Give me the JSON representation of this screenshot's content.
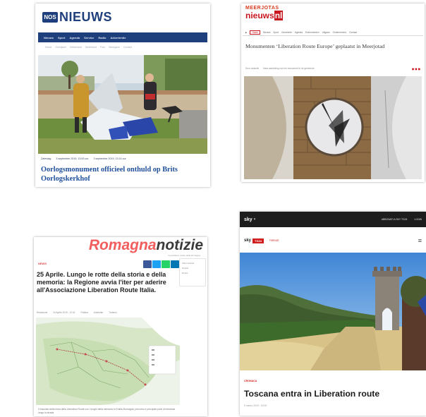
{
  "card1": {
    "logo_badge": "NOS",
    "logo_text": "NIEUWS",
    "nav": [
      "Nieuws",
      "Sport",
      "Agenda",
      "Service",
      "Radio",
      "Advertentie"
    ],
    "subnav": [
      "Home",
      "Overijssel",
      "Gelderland",
      "Nederland",
      "Foto",
      "Weergave",
      "Contact"
    ],
    "meta": [
      "Zaterdag",
      "3 september 2019, 13:00 uur",
      "3 september 2019, 13:14 uur"
    ],
    "headline": "Oorlogsmonument officieel onthuld op Brits Oorlogskerkhof"
  },
  "card2": {
    "logo_top": "MEERJOTAS",
    "logo_main_a": "nieuws",
    "logo_main_b": "nl",
    "nav": [
      "▶",
      "Home",
      "Nieuws",
      "Sport",
      "Gemeente",
      "Agenda",
      "Evenementen",
      "Uitgaan",
      "Ondernemers",
      "Contact"
    ],
    "nav_active": "Home",
    "headline": "Monumenten ‘Liberation Route Europe’ geplaatst in Meerjotad",
    "meta": [
      "Door redactie",
      "Naar aanleiding van het monument in de gemeente"
    ],
    "meta_icons": "◼ ◼ ◼"
  },
  "card3": {
    "logo_a": "Romagna",
    "logo_b": "notizie",
    "tagline": "il quotidiano online della Romagna",
    "category": "NEWS",
    "headline": "25 Aprile. Lungo le rotte della storia e della memoria: la Regione avvia l'iter per aderire all'Associazione Liberation Route Italia.",
    "meta": [
      "Redazione",
      "24 Aprile 2019 - 12:42",
      "Politica",
      "Ambiente",
      "Turismo"
    ],
    "sidebar": [
      "Ultimi articoli",
      "Notizie",
      "Rimini"
    ],
    "caption": "Il tracciato della linea della Liberation Route con i luoghi della memoria in Emilia-Romagna, percorso e principali punti di interesse lungo la strada"
  },
  "card4": {
    "sky": "sky",
    "top_right": [
      "ABBONATI A SKY TG24",
      "LOGIN"
    ],
    "sky_small": "sky",
    "tg": "TG24",
    "section": "FIRENZE",
    "category": "CRONACA",
    "headline": "Toscana entra in Liberation route",
    "date": "5 marzo 2019 - 15:00"
  },
  "colors": {
    "nos_blue": "#1f3f7c",
    "nos_headline": "#1f4f9b",
    "meerjotas_red": "#c7161d",
    "romagna_red": "#f25d5d",
    "sky_red": "#d11c1c"
  }
}
